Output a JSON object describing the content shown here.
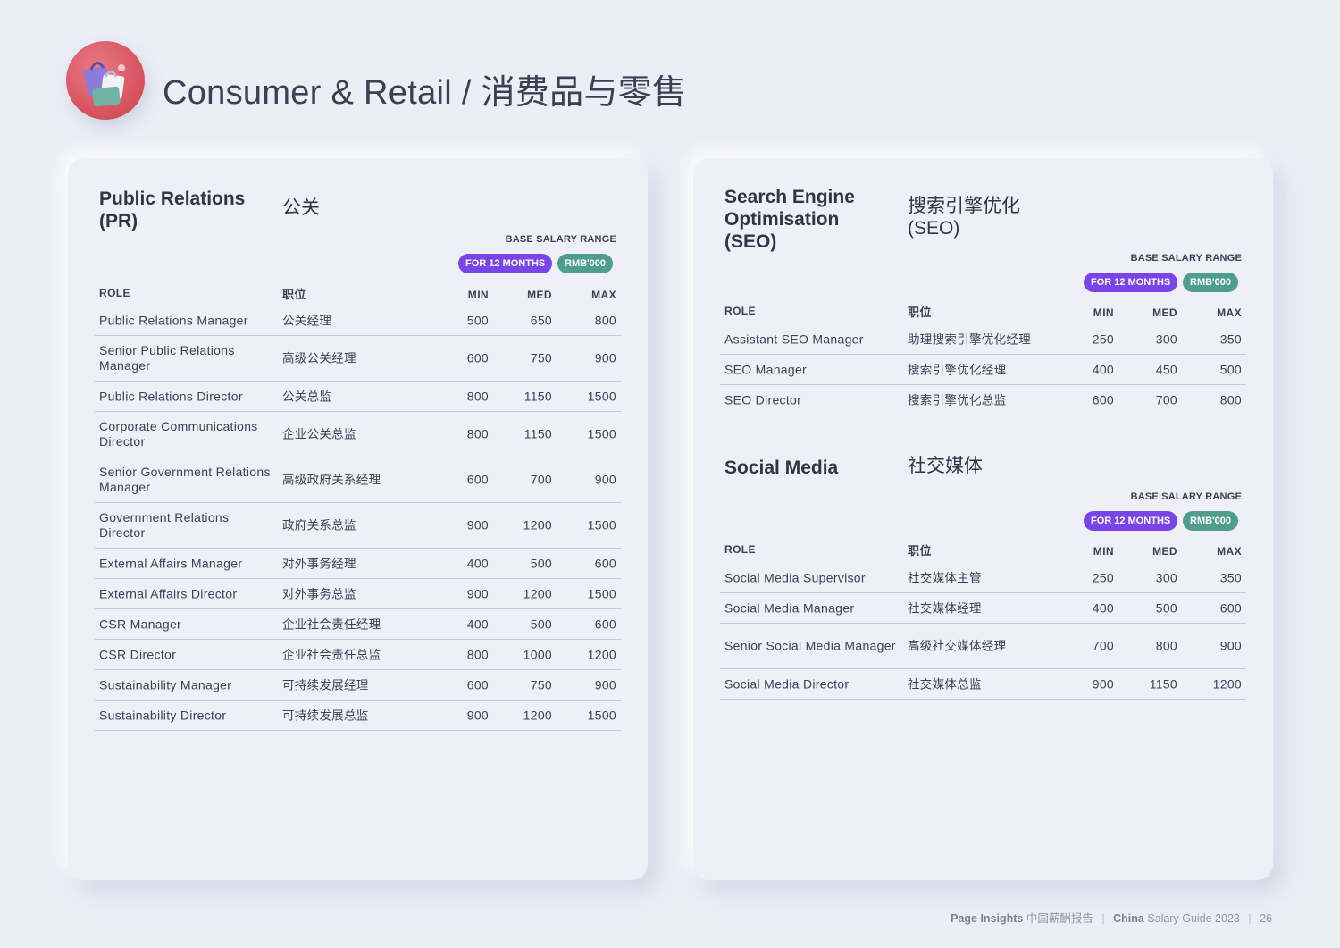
{
  "header": {
    "title": "Consumer & Retail / 消费品与零售",
    "icon": "shopping-bags-illustration"
  },
  "badges": {
    "range_label": "BASE SALARY RANGE",
    "months": "FOR 12 MONTHS",
    "currency": "RMB'000"
  },
  "columns": {
    "role": "ROLE",
    "zh": "职位",
    "min": "MIN",
    "med": "MED",
    "max": "MAX"
  },
  "pr": {
    "title_en": "Public Relations (PR)",
    "title_zh": "公关",
    "rows": [
      {
        "role": "Public Relations Manager",
        "zh": "公关经理",
        "min": "500",
        "med": "650",
        "max": "800"
      },
      {
        "role": "Senior Public Relations Manager",
        "zh": "高级公关经理",
        "min": "600",
        "med": "750",
        "max": "900"
      },
      {
        "role": "Public Relations Director",
        "zh": "公关总监",
        "min": "800",
        "med": "1150",
        "max": "1500"
      },
      {
        "role": "Corporate Communications Director",
        "zh": "企业公关总监",
        "min": "800",
        "med": "1150",
        "max": "1500"
      },
      {
        "role": "Senior Government Relations Manager",
        "zh": "高级政府关系经理",
        "min": "600",
        "med": "700",
        "max": "900"
      },
      {
        "role": "Government Relations Director",
        "zh": "政府关系总监",
        "min": "900",
        "med": "1200",
        "max": "1500"
      },
      {
        "role": "External Affairs Manager",
        "zh": "对外事务经理",
        "min": "400",
        "med": "500",
        "max": "600"
      },
      {
        "role": "External Affairs Director",
        "zh": "对外事务总监",
        "min": "900",
        "med": "1200",
        "max": "1500"
      },
      {
        "role": "CSR Manager",
        "zh": "企业社会责任经理",
        "min": "400",
        "med": "500",
        "max": "600"
      },
      {
        "role": "CSR Director",
        "zh": "企业社会责任总监",
        "min": "800",
        "med": "1000",
        "max": "1200"
      },
      {
        "role": "Sustainability Manager",
        "zh": "可持续发展经理",
        "min": "600",
        "med": "750",
        "max": "900"
      },
      {
        "role": "Sustainability Director",
        "zh": "可持续发展总监",
        "min": "900",
        "med": "1200",
        "max": "1500"
      }
    ]
  },
  "seo": {
    "title_en": "Search Engine Optimisation (SEO)",
    "title_zh": "搜索引擎优化 (SEO)",
    "rows": [
      {
        "role": "Assistant SEO Manager",
        "zh": "助理搜索引擎优化经理",
        "min": "250",
        "med": "300",
        "max": "350"
      },
      {
        "role": "SEO Manager",
        "zh": "搜索引擎优化经理",
        "min": "400",
        "med": "450",
        "max": "500"
      },
      {
        "role": "SEO Director",
        "zh": "搜索引擎优化总监",
        "min": "600",
        "med": "700",
        "max": "800"
      }
    ]
  },
  "social": {
    "title_en": "Social Media",
    "title_zh": "社交媒体",
    "rows": [
      {
        "role": "Social Media Supervisor",
        "zh": "社交媒体主管",
        "min": "250",
        "med": "300",
        "max": "350"
      },
      {
        "role": "Social Media Manager",
        "zh": "社交媒体经理",
        "min": "400",
        "med": "500",
        "max": "600"
      },
      {
        "role": "Senior Social Media Manager",
        "zh": "高级社交媒体经理",
        "min": "700",
        "med": "800",
        "max": "900"
      },
      {
        "role": "Social Media Director",
        "zh": "社交媒体总监",
        "min": "900",
        "med": "1150",
        "max": "1200"
      }
    ]
  },
  "footer": {
    "brand": "Page Insights",
    "brand_zh": "中国薪酬报告",
    "guide_bold": "China",
    "guide": "Salary Guide 2023",
    "page": "26"
  },
  "colors": {
    "background": "#eceef6",
    "card": "#eff0f7",
    "months_badge": "#7a45e8",
    "currency_badge": "#4f9e8d",
    "icon_circle": "#d95562"
  }
}
